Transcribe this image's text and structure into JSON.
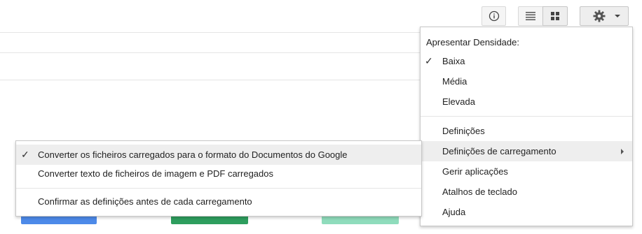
{
  "toolbar": {
    "info_icon": "info-circle-icon",
    "list_view_icon": "list-view-icon",
    "grid_view_icon": "grid-view-icon",
    "settings_icon": "gear-icon"
  },
  "settings_menu": {
    "density_header": "Apresentar Densidade:",
    "density_options": [
      {
        "label": "Baixa",
        "checked": true
      },
      {
        "label": "Média",
        "checked": false
      },
      {
        "label": "Elevada",
        "checked": false
      }
    ],
    "items": [
      {
        "label": "Definições"
      },
      {
        "label": "Definições de carregamento",
        "has_submenu": true
      },
      {
        "label": "Gerir aplicações"
      },
      {
        "label": "Atalhos de teclado"
      },
      {
        "label": "Ajuda"
      }
    ]
  },
  "upload_submenu": {
    "items": [
      {
        "label": "Converter os ficheiros carregados para o formato do Documentos do Google",
        "checked": true
      },
      {
        "label": "Converter texto de ficheiros de imagem e PDF carregados",
        "checked": false
      },
      {
        "label": "Confirmar as definições antes de cada carregamento",
        "checked": false
      }
    ]
  },
  "colors": {
    "blue_button": "#4d8ae9",
    "green_button": "#2e9e5e",
    "light_green_button": "#8fdcbc"
  }
}
